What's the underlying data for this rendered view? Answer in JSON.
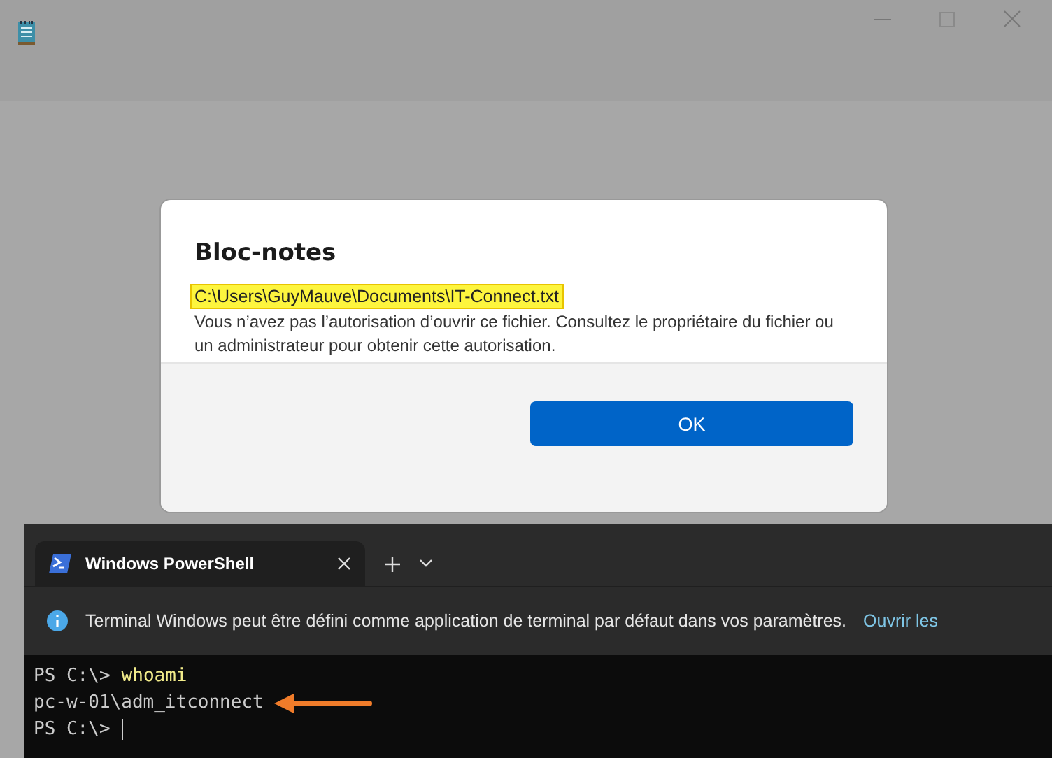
{
  "dialog": {
    "title": "Bloc-notes",
    "path": "C:\\Users\\GuyMauve\\Documents\\IT-Connect.txt",
    "path_highlighted": true,
    "message": "Vous n’avez pas l’autorisation d’ouvrir ce fichier. Consultez le propriétaire du fichier ou un administrateur pour obtenir cette autorisation.",
    "button": "OK"
  },
  "terminal": {
    "tabs": [
      {
        "label": "Windows PowerShell",
        "selected": true
      }
    ],
    "infobar": {
      "text": "Terminal Windows peut être défini comme application de terminal par défaut dans vos paramètres.",
      "link": "Ouvrir les"
    },
    "lines": [
      {
        "prompt": "PS C:\\>",
        "command": "whoami"
      },
      {
        "output": "pc-w-01\\adm_itconnect",
        "arrow": true
      },
      {
        "prompt": "PS C:\\>",
        "cursor": true
      }
    ]
  }
}
